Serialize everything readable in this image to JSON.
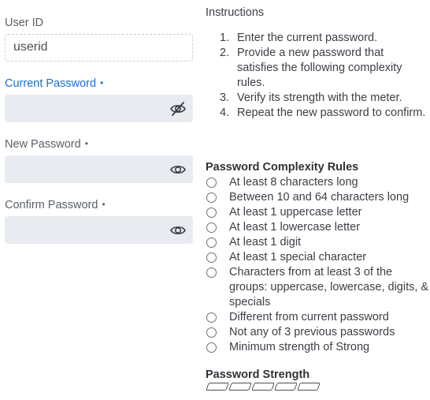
{
  "form": {
    "userid": {
      "label": "User ID",
      "value": "userid"
    },
    "current_password": {
      "label": "Current Password",
      "required_marker": "•",
      "value": "",
      "visibility_icon": "eye-slash-icon"
    },
    "new_password": {
      "label": "New Password",
      "required_marker": "•",
      "value": "",
      "visibility_icon": "eye-icon"
    },
    "confirm_password": {
      "label": "Confirm Password",
      "required_marker": "•",
      "value": "",
      "visibility_icon": "eye-icon"
    }
  },
  "instructions": {
    "title": "Instructions",
    "steps": [
      {
        "num": "1.",
        "text": "Enter the current password."
      },
      {
        "num": "2.",
        "text": "Provide a new password that satisfies the following complexity rules."
      },
      {
        "num": "3.",
        "text": "Verify its strength with the meter."
      },
      {
        "num": "4.",
        "text": "Repeat the new password to confirm."
      }
    ]
  },
  "complexity": {
    "title": "Password Complexity Rules",
    "rules": [
      "At least 8 characters long",
      "Between 10 and 64 characters long",
      "At least 1 uppercase letter",
      "At least 1 lowercase letter",
      "At least 1 digit",
      "At least 1 special character",
      "Characters from at least 3 of the groups: uppercase, lowercase, digits, & specials",
      "Different from current password",
      "Not any of 3 previous passwords",
      "Minimum strength of Strong"
    ]
  },
  "strength": {
    "title": "Password Strength",
    "segments_total": 5,
    "segments_filled": 0
  },
  "colors": {
    "active_label": "#1e6fcc",
    "input_bg": "#e8ebef"
  }
}
